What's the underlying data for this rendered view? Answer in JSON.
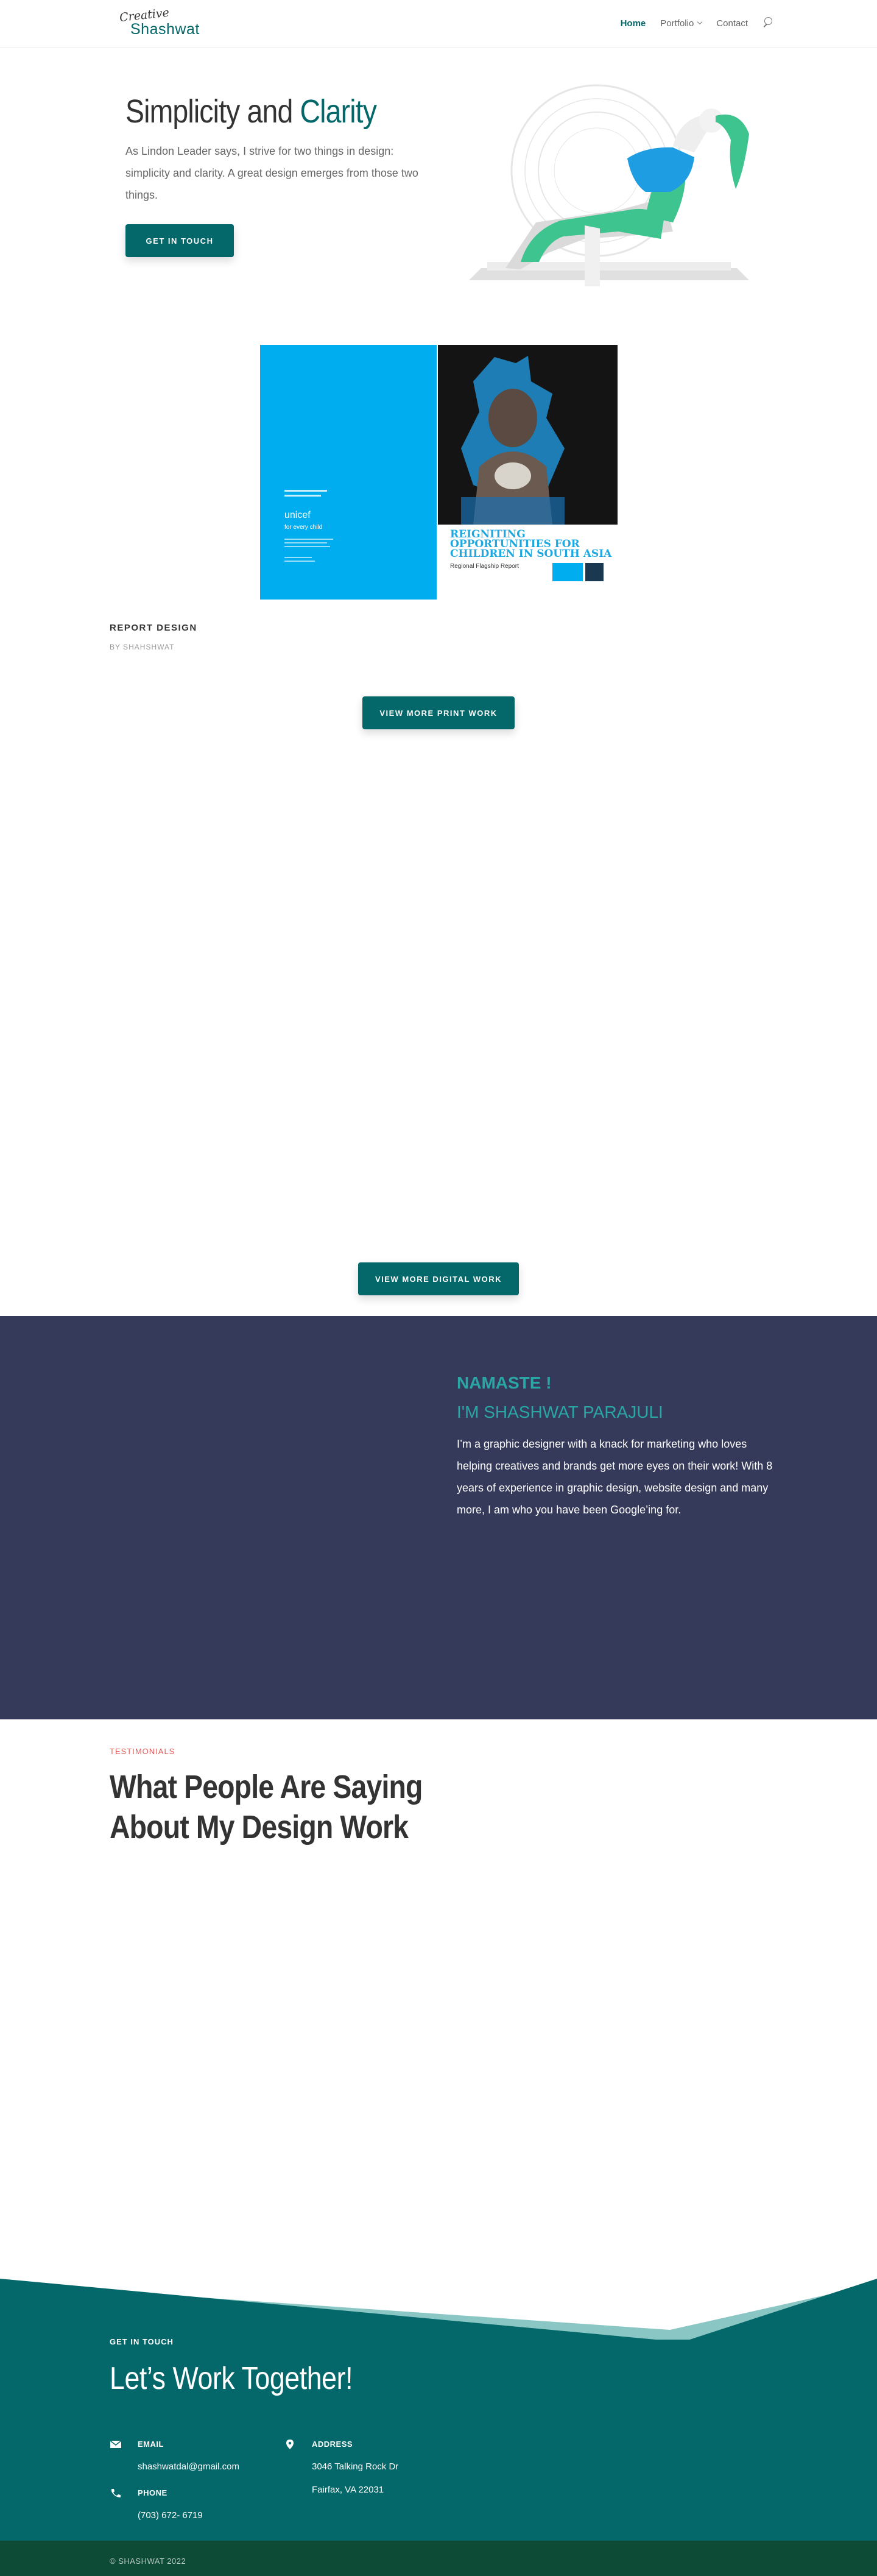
{
  "header": {
    "logo_script": "Creative",
    "logo_name": "Shashwat",
    "nav": {
      "home": "Home",
      "portfolio": "Portfolio",
      "contact": "Contact"
    }
  },
  "hero": {
    "title_part1": "Simplicity and ",
    "title_part2": "Clarity",
    "text": "As Lindon Leader says, I strive for two things in design: simplicity and clarity. A great design emerges from those two things.",
    "button": "GET IN TOUCH"
  },
  "portfolio": {
    "brochure": {
      "headline_line1": "REIGNITING",
      "headline_line2": "OPPORTUNITIES FOR",
      "headline_line3": "CHILDREN IN SOUTH ASIA",
      "subtitle": "Regional Flagship Report",
      "back_logo": "unicef",
      "back_tagline": "for every child"
    },
    "item_title": "REPORT DESIGN",
    "item_by": "BY SHAHSHWAT",
    "print_button": "VIEW MORE PRINT WORK",
    "digital_button": "VIEW MORE DIGITAL WORK"
  },
  "about": {
    "heading1": "NAMASTE !",
    "heading2": "I'M SHASHWAT PARAJULI",
    "text": " I’m a graphic designer with a knack for marketing who loves helping creatives and brands get more eyes on their work! With 8 years of experience in graphic design,  website design and many more, I am who you have been Google’ing for."
  },
  "testimonials": {
    "label": "TESTIMONIALS",
    "title": "What People Are Saying About My Design Work"
  },
  "footer": {
    "eyebrow": "GET IN TOUCH",
    "title": "Let’s Work Together!",
    "email_label": "EMAIL",
    "email_value": "shashwatdal@gmail.com",
    "phone_label": "PHONE",
    "phone_value": "(703) 672- 6719",
    "address_label": "ADDRESS",
    "address_line1": "3046 Talking Rock Dr",
    "address_line2": "Fairfax, VA 22031",
    "copyright": "© SHASHWAT 2022"
  },
  "colors": {
    "brand": "#04686a",
    "about_bg": "#35395a",
    "about_accent": "#2aa6a5",
    "testimonial_label": "#e45a5a",
    "footer_bottom": "#0d4b37",
    "brochure_blue": "#00aeef"
  },
  "icons": [
    "search-icon",
    "chevron-down-icon",
    "email-icon",
    "phone-icon",
    "location-pin-icon"
  ]
}
